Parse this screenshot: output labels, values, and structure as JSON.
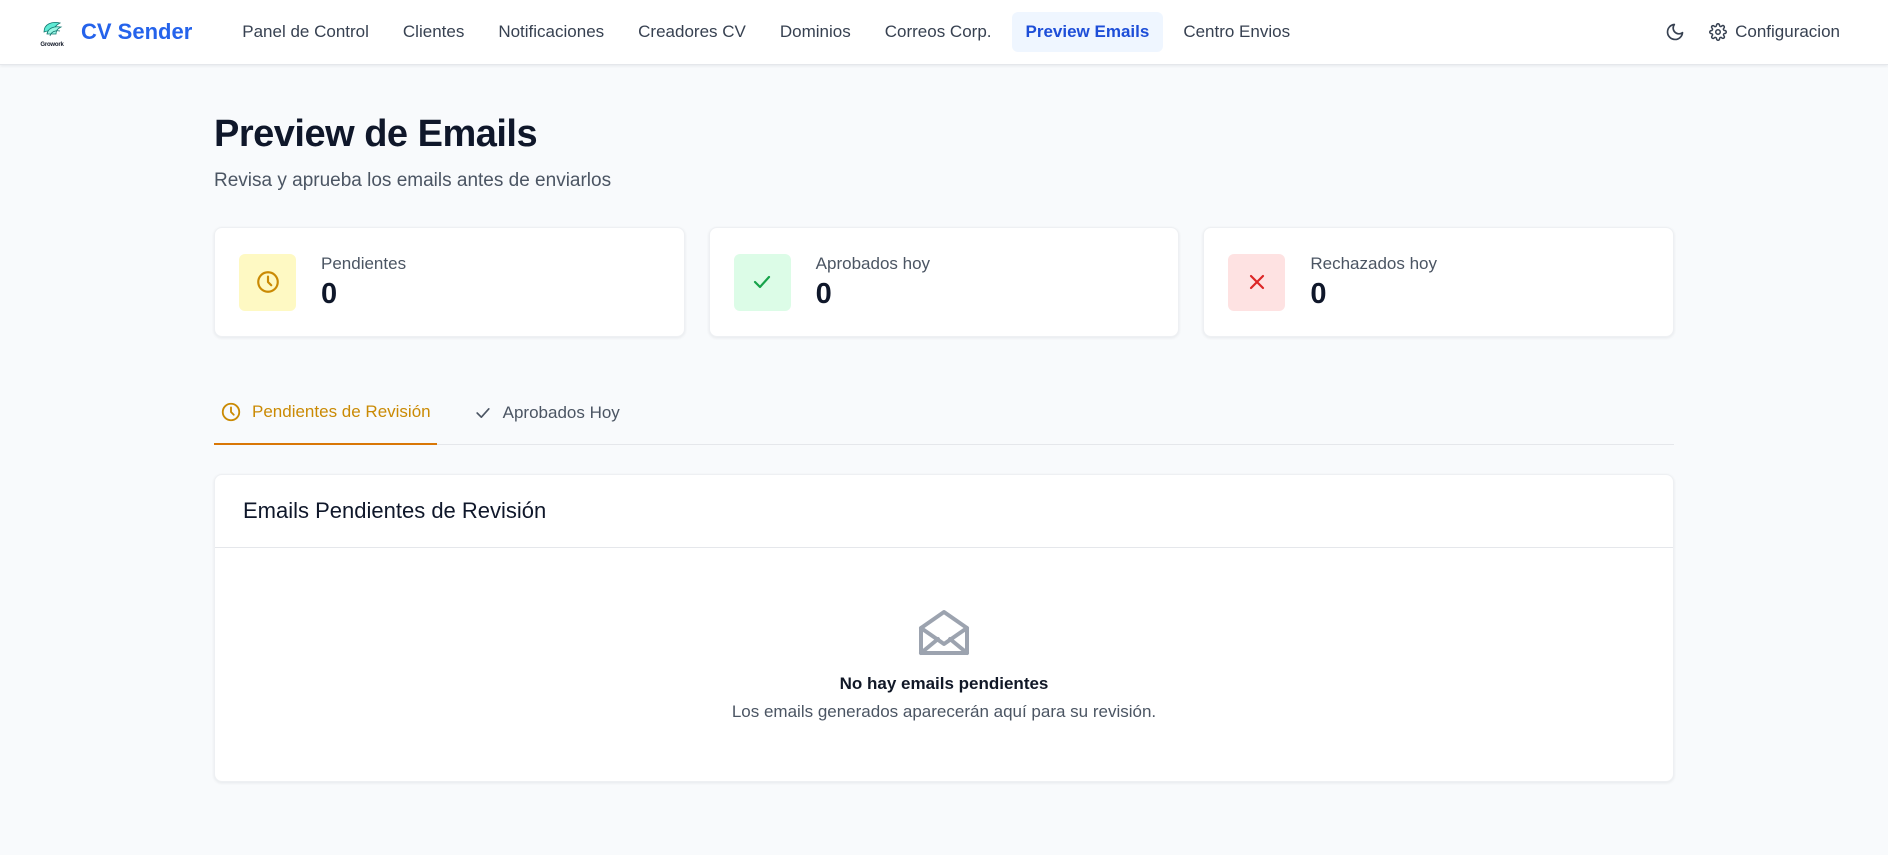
{
  "app": {
    "logo_text": "Growork",
    "name": "CV Sender"
  },
  "nav": {
    "items": [
      {
        "label": "Panel de Control",
        "active": false
      },
      {
        "label": "Clientes",
        "active": false
      },
      {
        "label": "Notificaciones",
        "active": false
      },
      {
        "label": "Creadores CV",
        "active": false
      },
      {
        "label": "Dominios",
        "active": false
      },
      {
        "label": "Correos Corp.",
        "active": false
      },
      {
        "label": "Preview Emails",
        "active": true
      },
      {
        "label": "Centro Envios",
        "active": false
      }
    ],
    "theme_icon": "moon-icon",
    "config": {
      "label": "Configuracion",
      "icon": "gear-icon"
    }
  },
  "page": {
    "title": "Preview de Emails",
    "subtitle": "Revisa y aprueba los emails antes de enviarlos"
  },
  "stats": [
    {
      "label": "Pendientes",
      "value": "0",
      "icon": "clock-icon",
      "icon_bg": "#fef9c3",
      "icon_color": "#ca8a04"
    },
    {
      "label": "Aprobados hoy",
      "value": "0",
      "icon": "check-icon",
      "icon_bg": "#dcfce7",
      "icon_color": "#16a34a"
    },
    {
      "label": "Rechazados hoy",
      "value": "0",
      "icon": "x-icon",
      "icon_bg": "#fee2e2",
      "icon_color": "#dc2626"
    }
  ],
  "tabs": [
    {
      "label": "Pendientes de Revisión",
      "icon": "clock-icon",
      "active": true
    },
    {
      "label": "Aprobados Hoy",
      "icon": "check-icon",
      "active": false
    }
  ],
  "panel": {
    "title": "Emails Pendientes de Revisión",
    "empty_icon": "envelope-open-icon",
    "empty_title": "No hay emails pendientes",
    "empty_desc": "Los emails generados aparecerán aquí para su revisión."
  },
  "colors": {
    "brand": "#2563eb",
    "active_tab": "#d97706",
    "background": "#f8fafc"
  }
}
